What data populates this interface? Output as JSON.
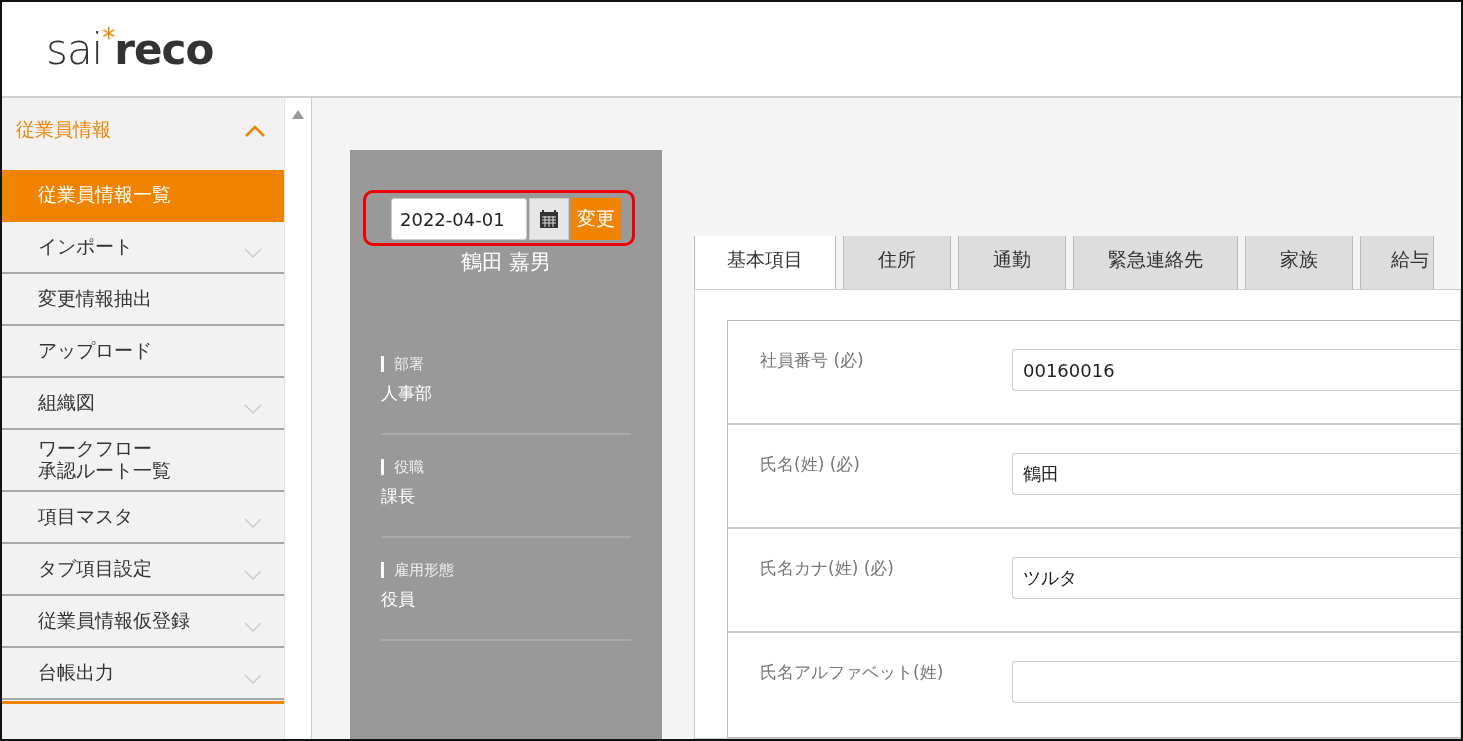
{
  "logo": {
    "light": "sai",
    "mark": "*",
    "bold": "reco"
  },
  "sidebar": {
    "section": {
      "label": "従業員情報",
      "expanded": true
    },
    "items": [
      {
        "label": "従業員情報一覧",
        "selected": true,
        "expandable": false
      },
      {
        "label": "インポート",
        "selected": false,
        "expandable": true
      },
      {
        "label": "変更情報抽出",
        "selected": false,
        "expandable": false
      },
      {
        "label": "アップロード",
        "selected": false,
        "expandable": false
      },
      {
        "label": "組織図",
        "selected": false,
        "expandable": true
      },
      {
        "lines": [
          "ワークフロー",
          "承認ルート一覧"
        ],
        "selected": false,
        "expandable": false
      },
      {
        "label": "項目マスタ",
        "selected": false,
        "expandable": true
      },
      {
        "label": "タブ項目設定",
        "selected": false,
        "expandable": true
      },
      {
        "label": "従業員情報仮登録",
        "selected": false,
        "expandable": true
      },
      {
        "label": "台帳出力",
        "selected": false,
        "expandable": true
      }
    ]
  },
  "profile": {
    "date": "2022-04-01",
    "change_button": "変更",
    "name": "鶴田 嘉男",
    "attributes": [
      {
        "label": "部署",
        "value": "人事部"
      },
      {
        "label": "役職",
        "value": "課長"
      },
      {
        "label": "雇用形態",
        "value": "役員"
      }
    ]
  },
  "tabs": [
    {
      "label": "基本項目",
      "selected": true
    },
    {
      "label": "住所",
      "selected": false
    },
    {
      "label": "通勤",
      "selected": false
    },
    {
      "label": "緊急連絡先",
      "selected": false
    },
    {
      "label": "家族",
      "selected": false
    },
    {
      "label": "給与",
      "selected": false
    }
  ],
  "fields": [
    {
      "label": "社員番号 (必)",
      "value": "00160016"
    },
    {
      "label": "氏名(姓) (必)",
      "value": "鶴田"
    },
    {
      "label": "氏名カナ(姓) (必)",
      "value": "ツルタ"
    },
    {
      "label": "氏名アルファベット(姓)"
    }
  ]
}
